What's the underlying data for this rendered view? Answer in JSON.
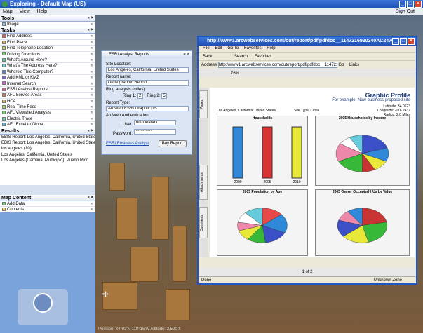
{
  "app": {
    "title": "Exploring - Default Map (US)",
    "menu": [
      "Map",
      "View",
      "Help"
    ],
    "signout": "Sign Out"
  },
  "sidebar": {
    "tools_header": "Tools",
    "tools_items": [
      "Image"
    ],
    "tasks_header": "Tasks",
    "tasks_items": [
      "Find Address",
      "Find Place",
      "Find Telephone Location",
      "Driving Directions",
      "What's Around Here?",
      "What's The Address Here?",
      "Where's This Computer?",
      "Add KML or KMZ",
      "Internet Search",
      "ESRI Analyst Reports",
      "AFL Service Areas",
      "HCA",
      "Real Time Feed",
      "AFL Viewshed Analysis",
      "Electric Trace",
      "AFL Excel to Globe"
    ],
    "results_header": "Results",
    "results_items": [
      "EBIS Report: Los Angeles, California, United State",
      "EBIS Report: Los Angeles, California, United States",
      "los angeles (10)",
      "Los Angeles, California, United States",
      "Los Angeles (Carolina, Municipio), Puerto Rico"
    ],
    "mapcontent_header": "Map Content",
    "mapcontent_items": [
      "Add Data",
      "Contents"
    ]
  },
  "esri": {
    "title": "ESRI Analyst Reports",
    "site_label": "Site Location:",
    "site_value": "Los Angeles, California, United States",
    "report_label": "Report name:",
    "report_value": "Demographic Report",
    "ring_label": "Ring analysis (miles):",
    "ring1_label": "Ring 1:",
    "ring1": "2",
    "ring2_label": "Ring 2:",
    "ring2": "5",
    "type_label": "Report Type:",
    "type_value": "ArcWeb:ESRI Graphic US",
    "auth_label": "ArcWeb Authentication:",
    "user_label": "User:",
    "user_value": "bozuklafahi",
    "pass_label": "Password:",
    "pass_value": "**********",
    "link": "ESRI Business Analyst",
    "buy_button": "Buy Report"
  },
  "ie": {
    "title": "http://www1.arcwebservices.com/out/report/pdf/pdfdoc__1147216920240AC24767...",
    "menu": [
      "File",
      "Edit",
      "Go To",
      "Favorites",
      "Help"
    ],
    "toolbar": {
      "back": "Back",
      "search": "Search",
      "favorites": "Favorites"
    },
    "address_label": "Address",
    "url": "http://www1.arcwebservices.com/out/report/pdf/pdfdoc__1147216920240A",
    "go": "Go",
    "links": "Links",
    "zoom": "76%",
    "sidetabs": [
      "Pages",
      "Attachments",
      "Comments"
    ],
    "page": "1 of 2",
    "status_left": "Done",
    "status_right": "Unknown Zone"
  },
  "report": {
    "title": "Graphic Profile",
    "subtitle": "For example: New business proposed site",
    "location": "Los Angeles, California, United States",
    "site_type": "Site Type: Circle",
    "latitude_label": "Latitude:",
    "latitude": "34.0523",
    "longitude_label": "Longitude:",
    "longitude": "-118.2437",
    "radius_label": "Radius:",
    "radius": "2.0 Miles",
    "chart1_title": "Households",
    "chart2_title": "2005 Households by Income",
    "chart3_title": "2005 Population by Age",
    "chart4_title": "2005 Owner Occupied HUs by Value"
  },
  "chart_data": [
    {
      "type": "bar",
      "title": "Households",
      "categories": [
        "2000",
        "2005",
        "2010"
      ],
      "values": [
        48,
        48,
        48
      ],
      "colors": [
        "#2f88d8",
        "#d83434",
        "#e8e838"
      ]
    },
    {
      "type": "pie",
      "title": "2005 Households by Income",
      "values": [
        20,
        12,
        10,
        8,
        18,
        16,
        8,
        8
      ],
      "colors": [
        "#3b4fc6",
        "#2f88d8",
        "#e8e838",
        "#c83434",
        "#38b838",
        "#ee88aa",
        "#ffffff",
        "#66ccdd"
      ]
    },
    {
      "type": "pie",
      "title": "2005 Population by Age",
      "values": [
        14,
        18,
        16,
        12,
        10,
        8,
        10,
        12
      ],
      "colors": [
        "#e84848",
        "#2f88d8",
        "#3b4fc6",
        "#38b838",
        "#e8e838",
        "#ee88aa",
        "#ffffff",
        "#66ccdd"
      ]
    },
    {
      "type": "pie",
      "title": "2005 Owner Occupied HUs by Value",
      "values": [
        22,
        24,
        18,
        16,
        10,
        10
      ],
      "colors": [
        "#c83434",
        "#38b838",
        "#e8e838",
        "#3b4fc6",
        "#ee88aa",
        "#2f88d8"
      ]
    }
  ],
  "map": {
    "coords": "Position: 34°03'N 118°15'W  Altitude: 2,500 ft"
  }
}
